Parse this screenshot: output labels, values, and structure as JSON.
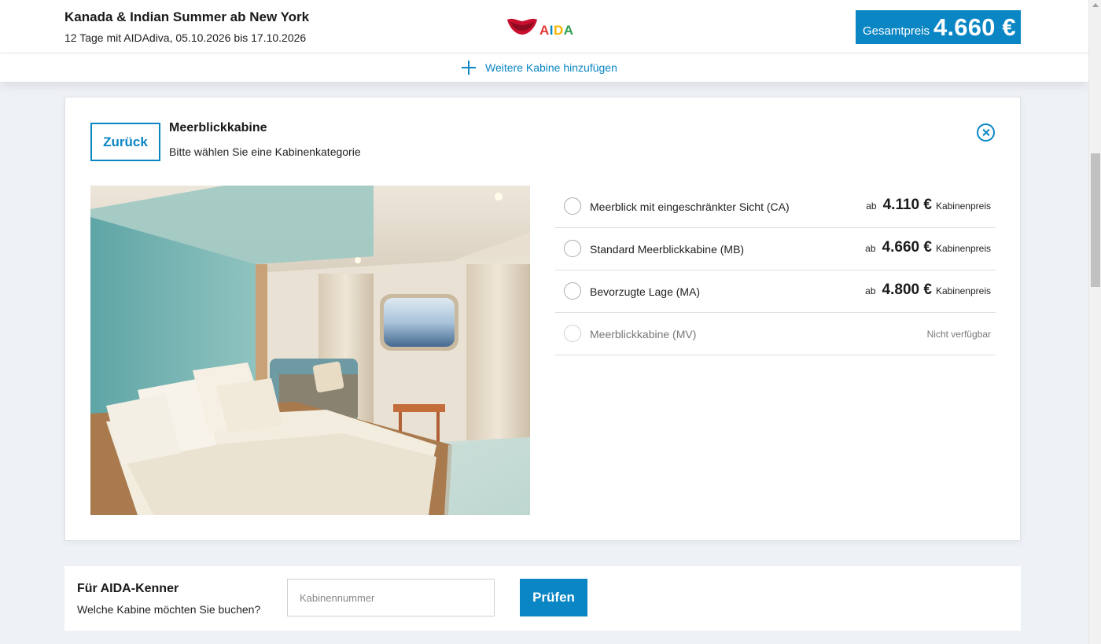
{
  "header": {
    "title": "Kanada & Indian Summer ab New York",
    "subtitle": "12 Tage mit AIDAdiva, 05.10.2026 bis 17.10.2026",
    "logo_text": "AIDA",
    "total_label": "Gesamtpreis",
    "total_value": "4.660 €"
  },
  "add_cabin": {
    "label": "Weitere Kabine hinzufügen"
  },
  "cabin_card": {
    "back_label": "Zurück",
    "title": "Meerblickkabine",
    "subtitle": "Bitte wählen Sie eine Kabinenkategorie",
    "options": [
      {
        "label": "Meerblick mit eingeschränkter Sicht (CA)",
        "prefix": "ab",
        "price": "4.110 €",
        "suffix": "Kabinenpreis"
      },
      {
        "label": "Standard Meerblickkabine (MB)",
        "prefix": "ab",
        "price": "4.660 €",
        "suffix": "Kabinenpreis"
      },
      {
        "label": "Bevorzugte Lage (MA)",
        "prefix": "ab",
        "price": "4.800 €",
        "suffix": "Kabinenpreis"
      },
      {
        "label": "Meerblickkabine (MV)",
        "status": "Nicht verfügbar"
      }
    ]
  },
  "kenner": {
    "title": "Für AIDA-Kenner",
    "subtitle": "Welche Kabine möchten Sie buchen?",
    "input_placeholder": "Kabinennummer",
    "button_label": "Prüfen"
  },
  "colors": {
    "accent": "#0a86c4"
  },
  "icons": [
    "aida-logo",
    "plus-icon",
    "close-icon",
    "radio-icon"
  ]
}
